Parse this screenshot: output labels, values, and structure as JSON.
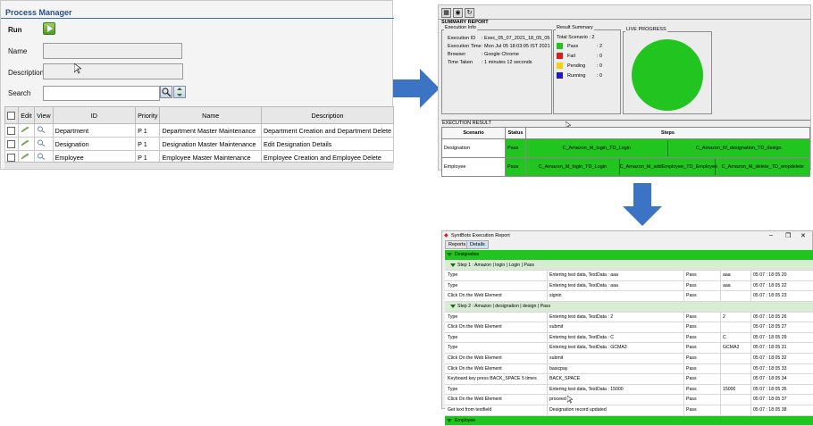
{
  "process_manager": {
    "title": "Process Manager",
    "run_label": "Run",
    "name_label": "Name",
    "description_label": "Description",
    "search_label": "Search",
    "columns": [
      "",
      "Edit",
      "View",
      "ID",
      "Priority",
      "Name",
      "Description"
    ],
    "rows": [
      {
        "id": "Department",
        "priority": "P 1",
        "name": "Department Master Maintenance",
        "description": "Department Creation and Department Delete"
      },
      {
        "id": "Designation",
        "priority": "P 1",
        "name": "Designation Master Maintenance",
        "description": "Edit Designation Details"
      },
      {
        "id": "Employee",
        "priority": "P 1",
        "name": "Employee Master Maintenance",
        "description": "Employee Creation and Employee Delete"
      }
    ]
  },
  "summary_report": {
    "title": "SUMMARY REPORT",
    "execution_info": {
      "caption": "Execution Info",
      "fields": [
        {
          "label": "Execution ID",
          "value": ": Exec_05_07_2021_18_05_05"
        },
        {
          "label": "Execution Time",
          "value": ": Mon Jul 05 18:03:05 IST 2021"
        },
        {
          "label": "Browser",
          "value": ": Google Chrome"
        },
        {
          "label": "Time Taken",
          "value": ": 1 minutes 12 seconds"
        }
      ]
    },
    "result_summary": {
      "caption": "Result Summary",
      "total": "Total Scenario : 2",
      "items": [
        {
          "label": "Pass",
          "value": ": 2",
          "color": "#22c41f"
        },
        {
          "label": "Fail",
          "value": ": 0",
          "color": "#e01b1b"
        },
        {
          "label": "Pending",
          "value": ": 0",
          "color": "#f2d20d"
        },
        {
          "label": "Running",
          "value": ": 0",
          "color": "#1b1bc9"
        }
      ]
    },
    "live_progress": {
      "caption": "LIVE PROGRESS",
      "color": "#22c41f"
    },
    "execution_result": {
      "caption": "EXECUTION RESULT",
      "headers": [
        "Scenario",
        "Status",
        "Steps"
      ],
      "rows": [
        {
          "scenario": "Designation",
          "status": "Pass",
          "steps": [
            "C_Amazon_M_login_TD_Login",
            "C_Amazon_M_designation_TD_design"
          ]
        },
        {
          "scenario": "Employee",
          "status": "Pass",
          "steps": [
            "C_Amazon_M_login_TD_Login",
            "C_Amazon_M_addEmployee_TD_Employee",
            "C_Amazon_M_delete_TD_empdelete"
          ]
        }
      ]
    }
  },
  "execution_report": {
    "window_title": "SyntBots Execution Report",
    "window_controls": [
      "–",
      "❐",
      "✕"
    ],
    "tabs": [
      "Reports",
      "Details"
    ],
    "rows": [
      {
        "kind": "group",
        "text": "Designation"
      },
      {
        "kind": "step",
        "text": "Step 1 : Amazon | login | Login | Pass"
      },
      {
        "kind": "data",
        "c1": "Type",
        "c2": "Entering test data, TestData : aaa",
        "c3": "Pass",
        "c4": "aaa",
        "c5": "05 07 : 18 05 20"
      },
      {
        "kind": "data",
        "c1": "Type",
        "c2": "Entering test data, TestData : aaa",
        "c3": "Pass",
        "c4": "aaa",
        "c5": "05 07 : 18 05 22"
      },
      {
        "kind": "data",
        "c1": "Click On the Web Element",
        "c2": "signin",
        "c3": "Pass",
        "c4": "",
        "c5": "05 07 : 18 05 23"
      },
      {
        "kind": "step",
        "text": "Step 2 : Amazon | designation | design | Pass"
      },
      {
        "kind": "data",
        "c1": "Type",
        "c2": "Entering test data, TestData : 2",
        "c3": "Pass",
        "c4": "2",
        "c5": "05 07 : 18 05 26"
      },
      {
        "kind": "data",
        "c1": "Click On the Web Element",
        "c2": "submit",
        "c3": "Pass",
        "c4": "",
        "c5": "05 07 : 18 05 27"
      },
      {
        "kind": "data",
        "c1": "Type",
        "c2": "Entering test data, TestData : C",
        "c3": "Pass",
        "c4": "C",
        "c5": "05 07 : 18 05 29"
      },
      {
        "kind": "data",
        "c1": "Type",
        "c2": "Entering test data, TestData : GCMA3",
        "c3": "Pass",
        "c4": "GCMA3",
        "c5": "05 07 : 18 05 31"
      },
      {
        "kind": "data",
        "c1": "Click On the Web Element",
        "c2": "submit",
        "c3": "Pass",
        "c4": "",
        "c5": "05 07 : 18 05 32"
      },
      {
        "kind": "data",
        "c1": "Click On the Web Element",
        "c2": "basicpay",
        "c3": "Pass",
        "c4": "",
        "c5": "05 07 : 18 05 33"
      },
      {
        "kind": "data",
        "c1": "Keyboard key press BACK_SPACE 5 times",
        "c2": "BACK_SPACE",
        "c3": "Pass",
        "c4": "",
        "c5": "05 07 : 18 05 34"
      },
      {
        "kind": "data",
        "c1": "Type",
        "c2": "Entering test data, TestData : 15000",
        "c3": "Pass",
        "c4": "15000",
        "c5": "05 07 : 18 05 35"
      },
      {
        "kind": "data",
        "c1": "Click On the Web Element",
        "c2": "proceed",
        "c3": "Pass",
        "c4": "",
        "c5": "05 07 : 18 05 37"
      },
      {
        "kind": "data",
        "c1": "Get text from textfield",
        "c2": "Designation record updated",
        "c3": "Pass",
        "c4": "",
        "c5": "05 07 : 18 05 38"
      },
      {
        "kind": "group",
        "text": "Employee"
      }
    ]
  },
  "colors": {
    "arrow": "#3b74c4",
    "pass_green": "#22c41f",
    "title_blue": "#2a4f8a"
  }
}
